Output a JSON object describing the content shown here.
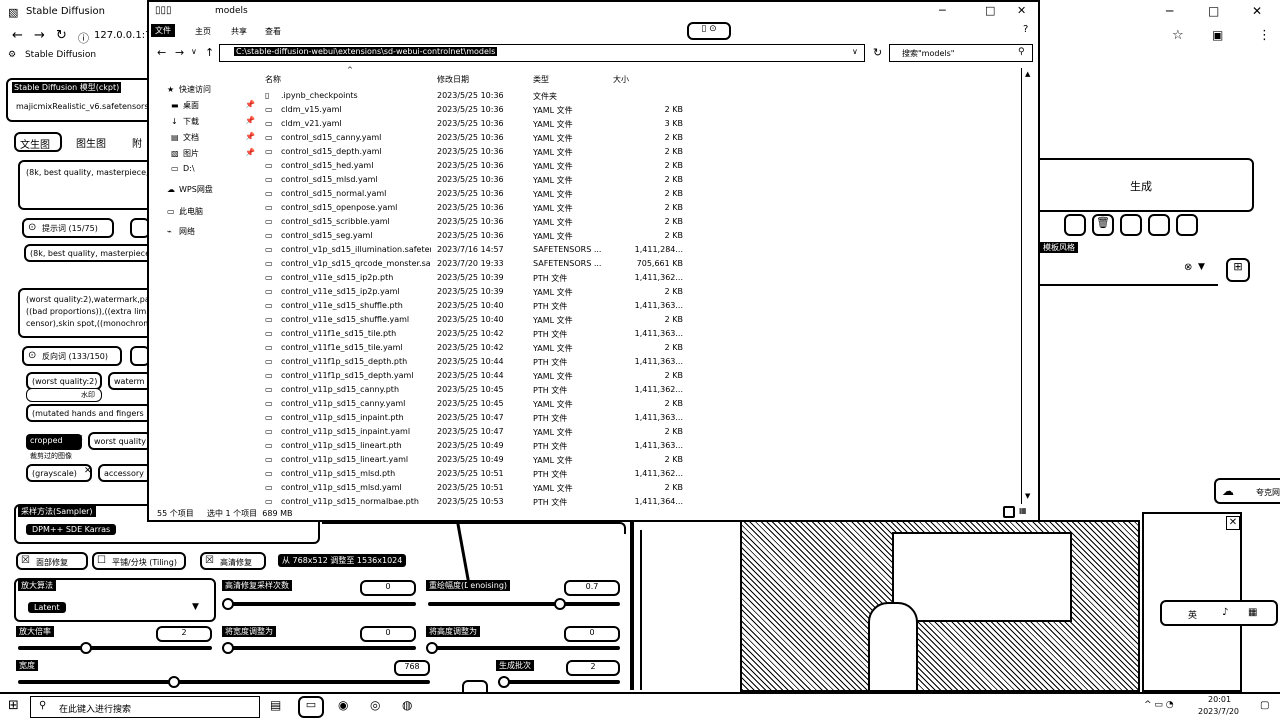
{
  "browser": {
    "tab_title": "Stable Diffusion",
    "url": "127.0.0.1:78",
    "bookmark": "Stable Diffusion",
    "window_controls": [
      "─",
      "□",
      "✕"
    ]
  },
  "sd": {
    "model_label": "Stable Diffusion 模型(ckpt)",
    "model_value": "majicmixRealistic_v6.safetensors",
    "tabs": [
      "文生图",
      "图生图",
      "附"
    ],
    "prompt_text": "(8k, best quality, masterpiece,",
    "prompt_words_label": "提示词 (15/75)",
    "prompt_chip": "(8k, best quality, masterpiece",
    "neg_prompt_text": "(worst quality:2),watermark,pa ((bad proportions)),((extra limb censor),skin spot,((monochrom",
    "neg_words_label": "反向词 (133/150)",
    "neg_chips": [
      "(worst quality:2)",
      "waterm",
      "水印",
      "(mutated hands and fingers",
      "cropped",
      "worst quality",
      "裁剪过的图像",
      "(grayscale)",
      "accessory"
    ],
    "sampler_label": "采样方法(Sampler)",
    "sampler_value": "DPM++ SDE Karras",
    "face_restore": "面部修复",
    "tiling": "平铺/分块 (Tiling)",
    "hires_fix": "高清修复",
    "hires_info": "从 768x512 调整至 1536x1024",
    "upscaler_label": "放大算法",
    "upscaler_value": "Latent",
    "hires_steps_label": "高清修复采样次数",
    "hires_steps_value": "0",
    "denoise_label": "重绘幅度(Denoising)",
    "denoise_value": "0.7",
    "upscale_by_label": "放大倍率",
    "upscale_by_value": "2",
    "resize_w_label": "将宽度调整为",
    "resize_w_value": "0",
    "resize_h_label": "将高度调整为",
    "resize_h_value": "0",
    "width_label": "宽度",
    "width_value": "768",
    "batch_label": "生成批次",
    "batch_value": "2",
    "generate_label": "生成",
    "style_label": "模板风格",
    "cloud_label": "夸克网"
  },
  "explorer": {
    "title": "models",
    "ribbon_tabs": [
      "文件",
      "主页",
      "共享",
      "查看"
    ],
    "path": "C:\\stable-diffusion-webui\\extensions\\sd-webui-controlnet\\models",
    "search_placeholder": "搜索\"models\"",
    "columns": [
      "名称",
      "修改日期",
      "类型",
      "大小"
    ],
    "nav": [
      {
        "icon": "★",
        "label": "快速访问"
      },
      {
        "icon": "▬",
        "label": "桌面"
      },
      {
        "icon": "↓",
        "label": "下载"
      },
      {
        "icon": "▤",
        "label": "文档"
      },
      {
        "icon": "▧",
        "label": "图片"
      },
      {
        "icon": "▭",
        "label": "D:\\"
      },
      {
        "icon": "☁",
        "label": "WPS网盘"
      },
      {
        "icon": "▭",
        "label": "此电脑"
      },
      {
        "icon": "⌁",
        "label": "网络"
      }
    ],
    "files": [
      {
        "name": ".ipynb_checkpoints",
        "date": "2023/5/25 10:36",
        "type": "文件夹",
        "size": ""
      },
      {
        "name": "cldm_v15.yaml",
        "date": "2023/5/25 10:36",
        "type": "YAML 文件",
        "size": "2 KB"
      },
      {
        "name": "cldm_v21.yaml",
        "date": "2023/5/25 10:36",
        "type": "YAML 文件",
        "size": "3 KB"
      },
      {
        "name": "control_sd15_canny.yaml",
        "date": "2023/5/25 10:36",
        "type": "YAML 文件",
        "size": "2 KB"
      },
      {
        "name": "control_sd15_depth.yaml",
        "date": "2023/5/25 10:36",
        "type": "YAML 文件",
        "size": "2 KB"
      },
      {
        "name": "control_sd15_hed.yaml",
        "date": "2023/5/25 10:36",
        "type": "YAML 文件",
        "size": "2 KB"
      },
      {
        "name": "control_sd15_mlsd.yaml",
        "date": "2023/5/25 10:36",
        "type": "YAML 文件",
        "size": "2 KB"
      },
      {
        "name": "control_sd15_normal.yaml",
        "date": "2023/5/25 10:36",
        "type": "YAML 文件",
        "size": "2 KB"
      },
      {
        "name": "control_sd15_openpose.yaml",
        "date": "2023/5/25 10:36",
        "type": "YAML 文件",
        "size": "2 KB"
      },
      {
        "name": "control_sd15_scribble.yaml",
        "date": "2023/5/25 10:36",
        "type": "YAML 文件",
        "size": "2 KB"
      },
      {
        "name": "control_sd15_seg.yaml",
        "date": "2023/5/25 10:36",
        "type": "YAML 文件",
        "size": "2 KB"
      },
      {
        "name": "control_v1p_sd15_illumination.safeten...",
        "date": "2023/7/16 14:57",
        "type": "SAFETENSORS ...",
        "size": "1,411,284..."
      },
      {
        "name": "control_v1p_sd15_qrcode_monster.sa...",
        "date": "2023/7/20 19:33",
        "type": "SAFETENSORS ...",
        "size": "705,661 KB"
      },
      {
        "name": "control_v11e_sd15_ip2p.pth",
        "date": "2023/5/25 10:39",
        "type": "PTH 文件",
        "size": "1,411,362..."
      },
      {
        "name": "control_v11e_sd15_ip2p.yaml",
        "date": "2023/5/25 10:39",
        "type": "YAML 文件",
        "size": "2 KB"
      },
      {
        "name": "control_v11e_sd15_shuffle.pth",
        "date": "2023/5/25 10:40",
        "type": "PTH 文件",
        "size": "1,411,363..."
      },
      {
        "name": "control_v11e_sd15_shuffle.yaml",
        "date": "2023/5/25 10:40",
        "type": "YAML 文件",
        "size": "2 KB"
      },
      {
        "name": "control_v11f1e_sd15_tile.pth",
        "date": "2023/5/25 10:42",
        "type": "PTH 文件",
        "size": "1,411,363..."
      },
      {
        "name": "control_v11f1e_sd15_tile.yaml",
        "date": "2023/5/25 10:42",
        "type": "YAML 文件",
        "size": "2 KB"
      },
      {
        "name": "control_v11f1p_sd15_depth.pth",
        "date": "2023/5/25 10:44",
        "type": "PTH 文件",
        "size": "1,411,363..."
      },
      {
        "name": "control_v11f1p_sd15_depth.yaml",
        "date": "2023/5/25 10:44",
        "type": "YAML 文件",
        "size": "2 KB"
      },
      {
        "name": "control_v11p_sd15_canny.pth",
        "date": "2023/5/25 10:45",
        "type": "PTH 文件",
        "size": "1,411,362..."
      },
      {
        "name": "control_v11p_sd15_canny.yaml",
        "date": "2023/5/25 10:45",
        "type": "YAML 文件",
        "size": "2 KB"
      },
      {
        "name": "control_v11p_sd15_inpaint.pth",
        "date": "2023/5/25 10:47",
        "type": "PTH 文件",
        "size": "1,411,363..."
      },
      {
        "name": "control_v11p_sd15_inpaint.yaml",
        "date": "2023/5/25 10:47",
        "type": "YAML 文件",
        "size": "2 KB"
      },
      {
        "name": "control_v11p_sd15_lineart.pth",
        "date": "2023/5/25 10:49",
        "type": "PTH 文件",
        "size": "1,411,363..."
      },
      {
        "name": "control_v11p_sd15_lineart.yaml",
        "date": "2023/5/25 10:49",
        "type": "YAML 文件",
        "size": "2 KB"
      },
      {
        "name": "control_v11p_sd15_mlsd.pth",
        "date": "2023/5/25 10:51",
        "type": "PTH 文件",
        "size": "1,411,362..."
      },
      {
        "name": "control_v11p_sd15_mlsd.yaml",
        "date": "2023/5/25 10:51",
        "type": "YAML 文件",
        "size": "2 KB"
      },
      {
        "name": "control_v11p_sd15_normalbae.pth",
        "date": "2023/5/25 10:53",
        "type": "PTH 文件",
        "size": "1,411,364..."
      }
    ],
    "status_count": "55 个项目",
    "status_selected": "选中 1 个项目  689 MB"
  },
  "taskbar": {
    "search_placeholder": "在此键入进行搜索",
    "time": "20:01",
    "date": "2023/7/20",
    "ime": "英"
  }
}
